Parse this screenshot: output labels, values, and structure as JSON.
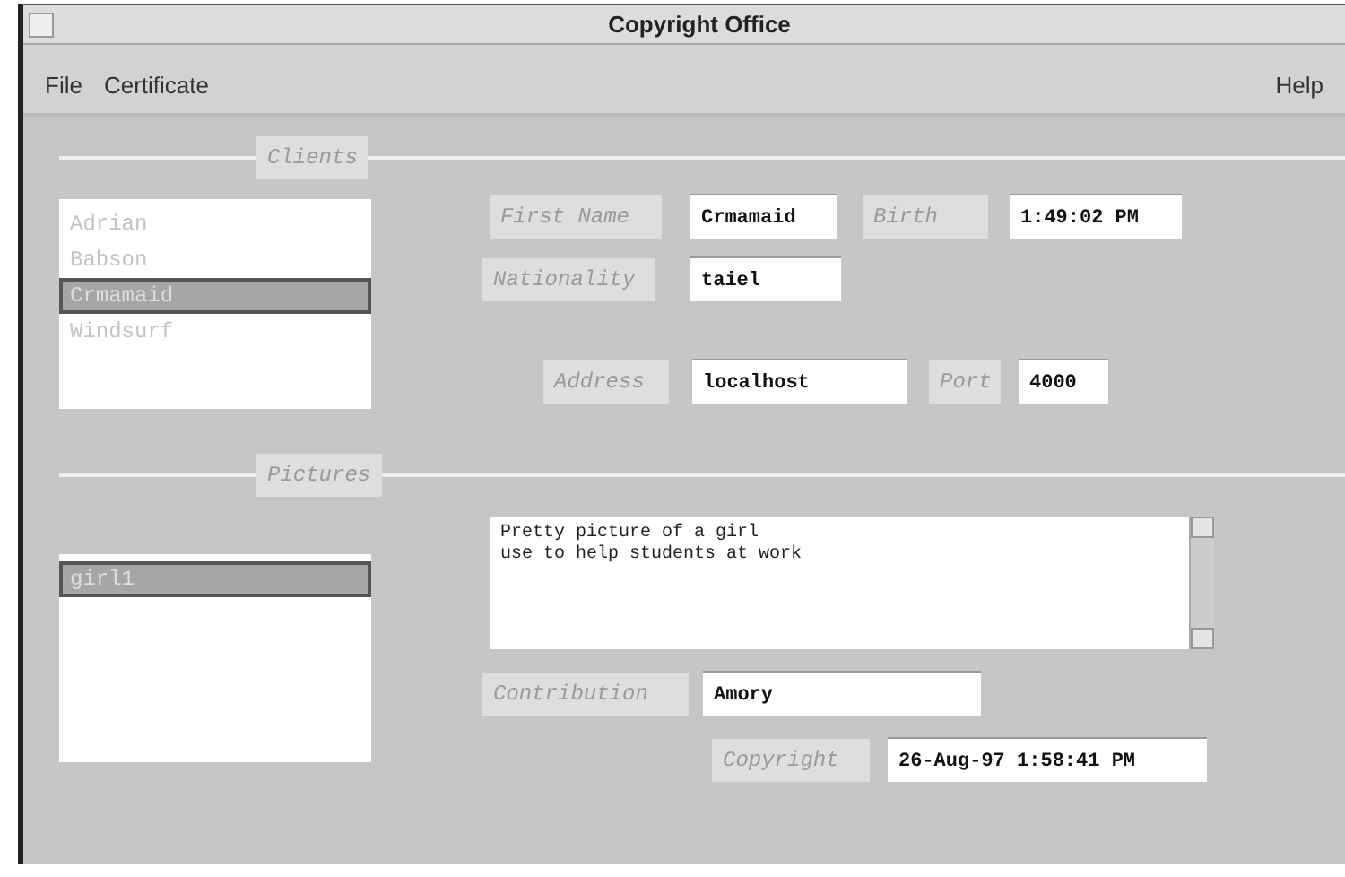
{
  "window": {
    "title": "Copyright Office"
  },
  "menu": {
    "left": [
      {
        "label": "File"
      },
      {
        "label": "Certificate"
      }
    ],
    "right": [
      {
        "label": "Help"
      }
    ]
  },
  "clients": {
    "heading": "Clients",
    "items": [
      {
        "label": "Adrian",
        "selected": false
      },
      {
        "label": "Babson",
        "selected": false
      },
      {
        "label": "Crmamaid",
        "selected": true
      },
      {
        "label": "Windsurf",
        "selected": false
      }
    ],
    "first_name": {
      "label": "First Name",
      "value": "Crmamaid"
    },
    "birth": {
      "label": "Birth",
      "value": "1:49:02 PM"
    },
    "nationality": {
      "label": "Nationality",
      "value": "taiel"
    },
    "address": {
      "label": "Address",
      "value": "localhost"
    },
    "port": {
      "label": "Port",
      "value": "4000"
    }
  },
  "pictures": {
    "heading": "Pictures",
    "items": [
      {
        "label": "girl1",
        "selected": true
      }
    ],
    "description": "Pretty picture of a girl\nuse to help students at work",
    "contribution": {
      "label": "Contribution",
      "value": "Amory"
    },
    "copyright": {
      "label": "Copyright",
      "value": "26-Aug-97 1:58:41 PM"
    }
  }
}
